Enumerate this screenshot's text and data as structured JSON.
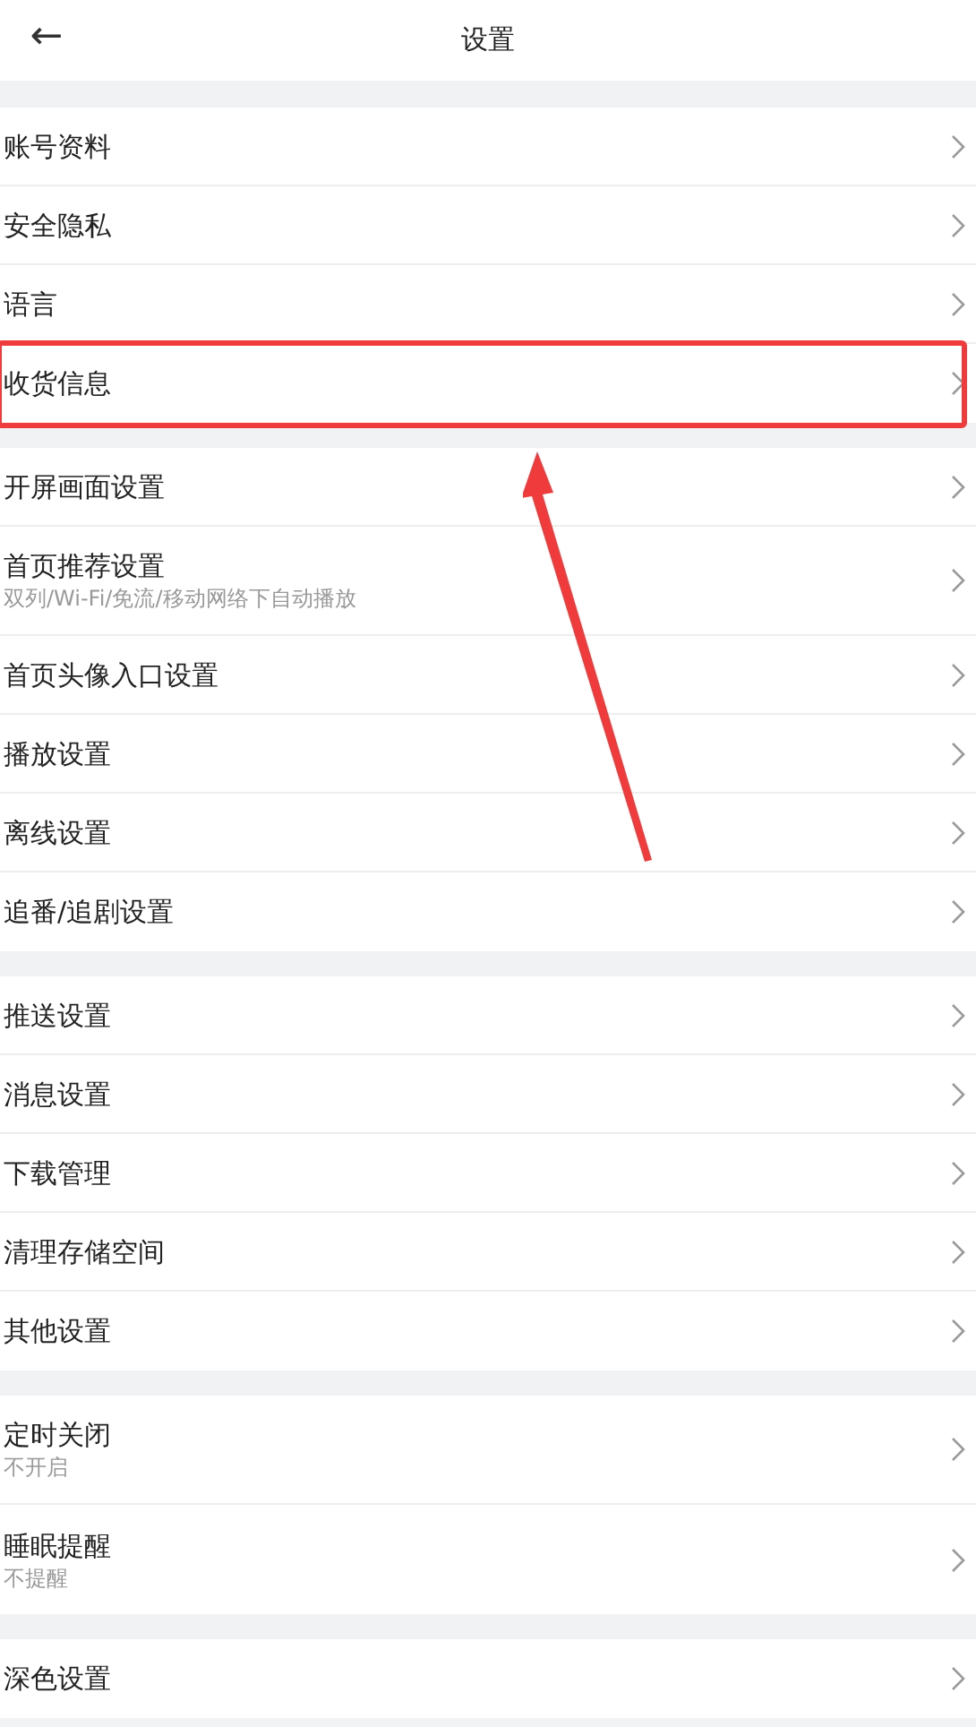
{
  "header": {
    "back": "←",
    "title": "设置"
  },
  "groups": [
    {
      "items": [
        {
          "title": "账号资料",
          "highlighted": false
        },
        {
          "title": "安全隐私",
          "highlighted": false
        },
        {
          "title": "语言",
          "highlighted": false
        },
        {
          "title": "收货信息",
          "highlighted": true
        }
      ]
    },
    {
      "items": [
        {
          "title": "开屏画面设置",
          "highlighted": false
        },
        {
          "title": "首页推荐设置",
          "subtitle": "双列/Wi-Fi/免流/移动网络下自动播放",
          "highlighted": false
        },
        {
          "title": "首页头像入口设置",
          "highlighted": false
        },
        {
          "title": "播放设置",
          "highlighted": false
        },
        {
          "title": "离线设置",
          "highlighted": false
        },
        {
          "title": "追番/追剧设置",
          "highlighted": false
        }
      ]
    },
    {
      "items": [
        {
          "title": "推送设置",
          "highlighted": false
        },
        {
          "title": "消息设置",
          "highlighted": false
        },
        {
          "title": "下载管理",
          "highlighted": false
        },
        {
          "title": "清理存储空间",
          "highlighted": false
        },
        {
          "title": "其他设置",
          "highlighted": false
        }
      ]
    },
    {
      "items": [
        {
          "title": "定时关闭",
          "subtitle": "不开启",
          "highlighted": false
        },
        {
          "title": "睡眠提醒",
          "subtitle": "不提醒",
          "highlighted": false
        }
      ]
    },
    {
      "items": [
        {
          "title": "深色设置",
          "highlighted": false
        }
      ]
    }
  ]
}
